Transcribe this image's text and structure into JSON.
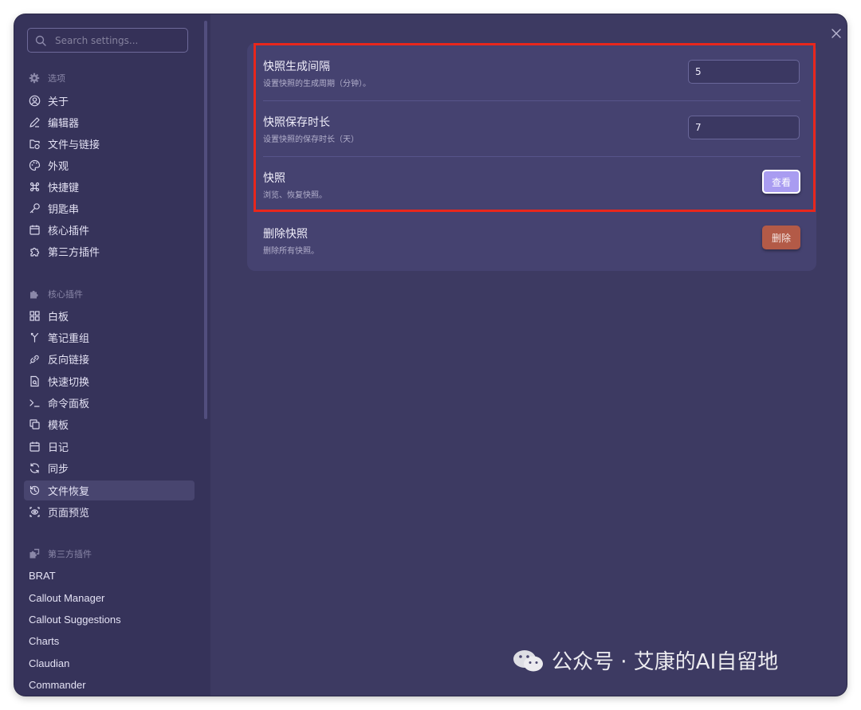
{
  "search": {
    "placeholder": "Search settings..."
  },
  "sidebar": {
    "sections": [
      {
        "title": "选项",
        "icon": "gear-icon"
      },
      {
        "title": "核心插件",
        "icon": "puzzle-icon"
      },
      {
        "title": "第三方插件",
        "icon": "puzzles-icon"
      }
    ],
    "options": [
      {
        "label": "关于",
        "icon": "user-circle-icon"
      },
      {
        "label": "编辑器",
        "icon": "pen-icon"
      },
      {
        "label": "文件与链接",
        "icon": "folder-link-icon"
      },
      {
        "label": "外观",
        "icon": "palette-icon"
      },
      {
        "label": "快捷键",
        "icon": "command-icon"
      },
      {
        "label": "钥匙串",
        "icon": "key-icon"
      },
      {
        "label": "核心插件",
        "icon": "calendar-box-icon"
      },
      {
        "label": "第三方插件",
        "icon": "puzzle-outline-icon"
      }
    ],
    "core_plugins": [
      {
        "label": "白板",
        "icon": "canvas-icon"
      },
      {
        "label": "笔记重组",
        "icon": "merge-icon"
      },
      {
        "label": "反向链接",
        "icon": "backlink-icon"
      },
      {
        "label": "快速切换",
        "icon": "file-search-icon"
      },
      {
        "label": "命令面板",
        "icon": "terminal-icon"
      },
      {
        "label": "模板",
        "icon": "copy-icon"
      },
      {
        "label": "日记",
        "icon": "calendar-icon"
      },
      {
        "label": "同步",
        "icon": "refresh-icon"
      },
      {
        "label": "文件恢复",
        "icon": "history-icon",
        "active": true
      },
      {
        "label": "页面预览",
        "icon": "preview-icon"
      }
    ],
    "third_party": [
      "BRAT",
      "Callout Manager",
      "Callout Suggestions",
      "Charts",
      "Claudian",
      "Commander"
    ]
  },
  "settings": {
    "interval": {
      "name": "快照生成间隔",
      "desc": "设置快照的生成周期（分钟）。",
      "value": "5"
    },
    "retention": {
      "name": "快照保存时长",
      "desc": "设置快照的保存时长（天）",
      "value": "7"
    },
    "snapshots": {
      "name": "快照",
      "desc": "浏览、恢复快照。",
      "button": "查看"
    },
    "delete": {
      "name": "删除快照",
      "desc": "删除所有快照。",
      "button": "删除"
    }
  },
  "watermark": {
    "text": "公众号 · 艾康的AI自留地"
  },
  "colors": {
    "accent": "#a99cf1",
    "danger": "#b35a47",
    "highlight": "#e8271c",
    "background": "#3d3a62"
  }
}
